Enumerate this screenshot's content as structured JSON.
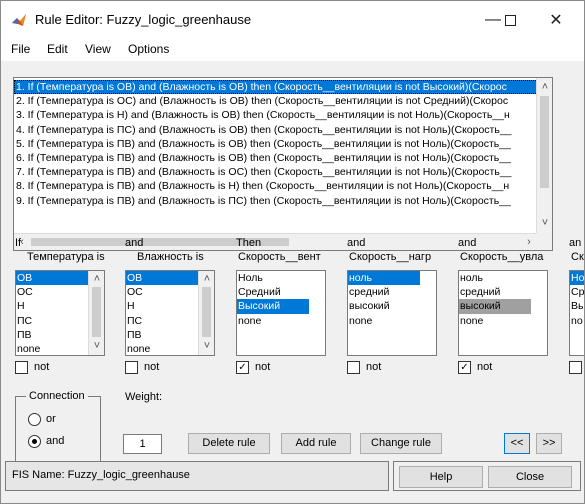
{
  "window": {
    "title": "Rule Editor: Fuzzy_logic_greenhause"
  },
  "menu": [
    "File",
    "Edit",
    "View",
    "Options"
  ],
  "rules": [
    "1. If (Температура is ОВ) and (Влажность is ОВ) then (Скорость__вентиляции is not Высокий)(Скорос",
    "2. If (Температура is ОС) and (Влажность is ОВ) then (Скорость__вентиляции is not Средний)(Скорос",
    "3. If (Температура is Н) and (Влажность is ОВ) then (Скорость__вентиляции is not Ноль)(Скорость__н",
    "4. If (Температура is ПС) and (Влажность is ОВ) then (Скорость__вентиляции is not Ноль)(Скорость__",
    "5. If (Температура is ПВ) and (Влажность is ОВ) then (Скорость__вентиляции is not Ноль)(Скорость__",
    "6. If (Температура is ПВ) and (Влажность is ОВ) then (Скорость__вентиляции is not Ноль)(Скорость__",
    "7. If (Температура is ПВ) and (Влажность is ОС) then (Скорость__вентиляции is not Ноль)(Скорость__",
    "8. If (Температура is ПВ) and (Влажность is Н) then (Скорость__вентиляции is not Ноль)(Скорость__н",
    "9. If (Температура is ПВ) and (Влажность is ПС) then (Скорость__вентиляции is not Ноль)(Скорость__"
  ],
  "columns": [
    {
      "conn": "If",
      "var": "Температура is",
      "items": [
        "ОВ",
        "ОС",
        "Н",
        "ПС",
        "ПВ",
        "none"
      ],
      "not_label": "not",
      "not_checked": false
    },
    {
      "conn": "and",
      "var": "Влажность is",
      "items": [
        "ОВ",
        "ОС",
        "Н",
        "ПС",
        "ПВ",
        "none"
      ],
      "not_label": "not",
      "not_checked": false
    },
    {
      "conn": "Then",
      "var": "Скорость__вент",
      "items": [
        "Ноль",
        "Средний",
        "Высокий",
        "none"
      ],
      "not_label": "not",
      "not_checked": true
    },
    {
      "conn": "and",
      "var": "Скорость__нагр",
      "items": [
        "ноль",
        "средний",
        "высокий",
        "none"
      ],
      "not_label": "not",
      "not_checked": false
    },
    {
      "conn": "and",
      "var": "Скорость__увла",
      "items": [
        "ноль",
        "средний",
        "высокий",
        "none"
      ],
      "not_label": "not",
      "not_checked": true
    },
    {
      "conn": "an",
      "var": "Ск",
      "items": [
        "Но",
        "Ср",
        "Вь",
        "no"
      ],
      "not_label": "",
      "not_checked": false
    }
  ],
  "connection": {
    "title": "Connection",
    "or_label": "or",
    "and_label": "and",
    "selected": "and"
  },
  "weight": {
    "label": "Weight:",
    "value": "1"
  },
  "buttons": {
    "delete_rule": "Delete rule",
    "add_rule": "Add rule",
    "change_rule": "Change rule",
    "prev": "<<",
    "next": ">>",
    "help": "Help",
    "close": "Close"
  },
  "status": {
    "fis_name": "FIS Name: Fuzzy_logic_greenhause"
  },
  "colors": {
    "selection": "#0078d7",
    "selection_inactive": "#a0a0a0"
  },
  "icons": [
    "matlab-icon",
    "minimize-icon",
    "maximize-icon",
    "close-icon",
    "chevron-up-icon",
    "chevron-down-icon",
    "chevron-left-icon",
    "chevron-right-icon",
    "checkmark-icon"
  ]
}
